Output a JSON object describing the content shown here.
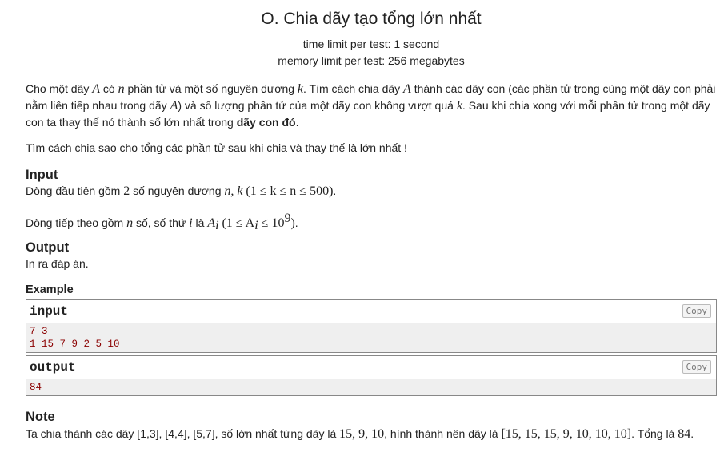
{
  "problem": {
    "title": "O. Chia dãy tạo tổng lớn nhất",
    "time_limit": "time limit per test: 1 second",
    "memory_limit": "memory limit per test: 256 megabytes"
  },
  "statement": {
    "p1_a": "Cho một dãy ",
    "p1_A": "A",
    "p1_b": " có ",
    "p1_n": "n",
    "p1_c": " phần tử và một số nguyên dương ",
    "p1_k": "k",
    "p1_d": ". Tìm cách chia dãy ",
    "p1_A2": "A",
    "p1_e": " thành các dãy con (các phần tử trong cùng một dãy con phải nằm liên tiếp nhau trong dãy ",
    "p1_A3": "A",
    "p1_f": ") và số lượng phần tử của một dãy con không vượt quá ",
    "p1_k2": "k",
    "p1_g": ". Sau khi chia xong với mỗi phần tử trong một dãy con ta thay thế nó thành số lớn nhất trong ",
    "p1_bold": "dãy con đó",
    "p1_h": ".",
    "p2": "Tìm cách chia sao cho tổng các phần tử sau khi chia và thay thế là lớn nhất !"
  },
  "input_section": {
    "heading": "Input",
    "l1_a": "Dòng đầu tiên gồm ",
    "l1_num": "2",
    "l1_b": " số nguyên dương ",
    "l1_vars": "n, k",
    "l1_cond": "(1 ≤ k ≤ n ≤ 500)",
    "l1_end": ".",
    "l2_a": "Dòng tiếp theo gồm ",
    "l2_n": "n",
    "l2_b": " số, số thứ ",
    "l2_i": "i",
    "l2_c": " là ",
    "l2_A": "A",
    "l2_sub": "i",
    "l2_cond_a": "(1 ≤ A",
    "l2_cond_sub": "i",
    "l2_cond_b": " ≤ 10",
    "l2_cond_sup": "9",
    "l2_cond_c": ")",
    "l2_end": "."
  },
  "output_section": {
    "heading": "Output",
    "text": "In ra đáp án."
  },
  "example": {
    "heading": "Example",
    "input_label": "input",
    "input_lines": [
      "7 3",
      "1 15 7 9 2 5 10"
    ],
    "output_label": "output",
    "output_lines": [
      "84"
    ],
    "copy_label": "Copy"
  },
  "note": {
    "heading": "Note",
    "a": "Ta chia thành các dãy [1,3], [4,4], [5,7], số lớn nhất từng dãy là ",
    "nums": "15, 9, 10",
    "b": ", hình thành nên dãy là ",
    "seq": "[15, 15, 15, 9, 10, 10, 10]",
    "c": ". Tổng là ",
    "total": "84",
    "d": "."
  }
}
